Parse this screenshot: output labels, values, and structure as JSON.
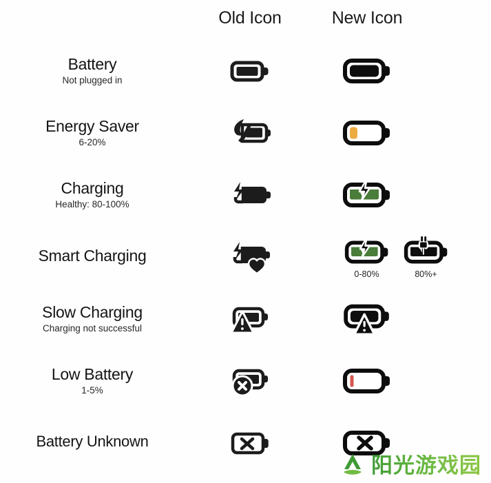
{
  "header": {
    "old_column": "Old Icon",
    "new_column": "New Icon"
  },
  "colors": {
    "ink": "#141414",
    "green": "#4a7c3a",
    "amber": "#eeab3f",
    "red": "#d4564f",
    "watermark_green": "#5aab3c"
  },
  "rows": [
    {
      "label": "Battery",
      "sublabel": "Not plugged in",
      "old_icon": "battery-full-old-icon",
      "new_icons": [
        {
          "icon": "battery-full-new-icon",
          "caption": ""
        }
      ]
    },
    {
      "label": "Energy Saver",
      "sublabel": "6-20%",
      "old_icon": "battery-leaf-old-icon",
      "new_icons": [
        {
          "icon": "battery-energy-saver-new-icon",
          "caption": ""
        }
      ]
    },
    {
      "label": "Charging",
      "sublabel": "Healthy: 80-100%",
      "old_icon": "battery-charging-old-icon",
      "new_icons": [
        {
          "icon": "battery-charging-new-icon",
          "caption": ""
        }
      ]
    },
    {
      "label": "Smart Charging",
      "sublabel": "",
      "old_icon": "battery-heart-old-icon",
      "new_icons": [
        {
          "icon": "battery-smart-charging-new-icon",
          "caption": "0-80%"
        },
        {
          "icon": "battery-plug-new-icon",
          "caption": "80%+"
        }
      ]
    },
    {
      "label": "Slow Charging",
      "sublabel": "Charging not successful",
      "old_icon": "battery-warning-old-icon",
      "new_icons": [
        {
          "icon": "battery-warning-new-icon",
          "caption": ""
        }
      ]
    },
    {
      "label": "Low Battery",
      "sublabel": "1-5%",
      "old_icon": "battery-error-old-icon",
      "new_icons": [
        {
          "icon": "battery-low-new-icon",
          "caption": ""
        }
      ]
    },
    {
      "label": "Battery Unknown",
      "sublabel": "",
      "old_icon": "battery-unknown-old-icon",
      "new_icons": [
        {
          "icon": "battery-unknown-new-icon",
          "caption": ""
        }
      ]
    }
  ],
  "watermark": {
    "text": "阳光游戏园",
    "logo": "mountain-logo-icon"
  }
}
